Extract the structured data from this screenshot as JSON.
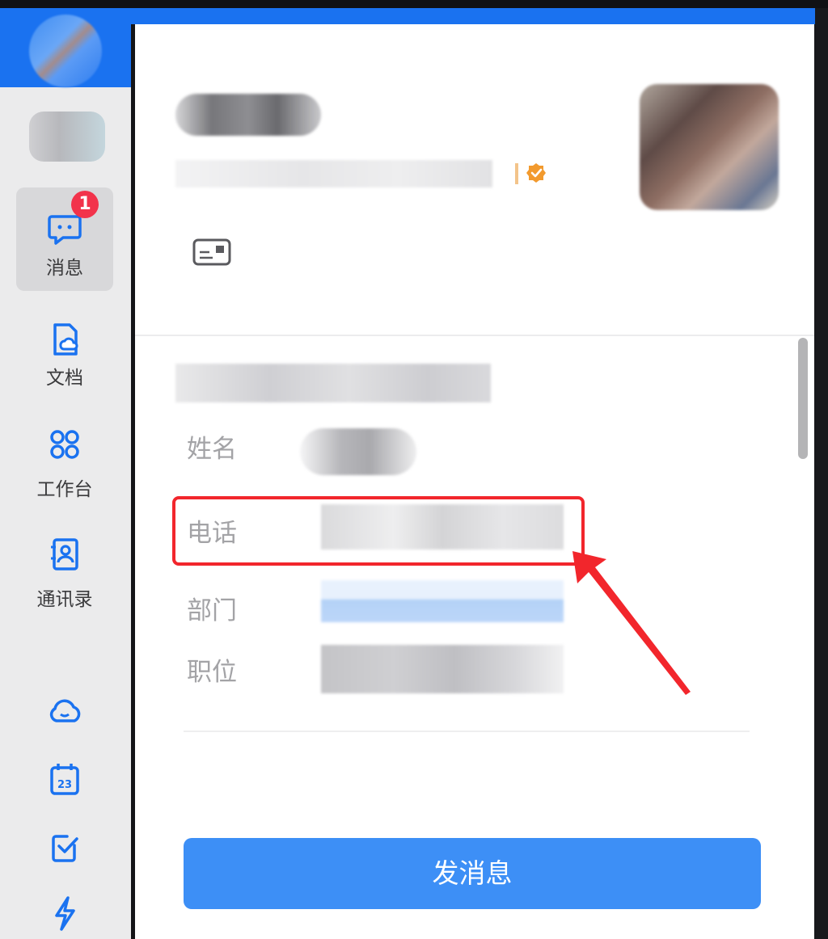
{
  "sidebar": {
    "nav": [
      {
        "label": "消息",
        "badge": "1",
        "icon": "chat-bubble-icon"
      },
      {
        "label": "文档",
        "icon": "document-cloud-icon"
      },
      {
        "label": "工作台",
        "icon": "apps-grid-icon"
      },
      {
        "label": "通讯录",
        "icon": "contacts-book-icon"
      }
    ],
    "bottom_icons": [
      "cloud-icon",
      "calendar-icon",
      "task-check-icon",
      "lightning-icon"
    ],
    "calendar_day": "23"
  },
  "profile": {
    "verified_icon": "verified-badge-icon",
    "card_icon": "business-card-icon",
    "fields": {
      "name_label": "姓名",
      "phone_label": "电话",
      "department_label": "部门",
      "position_label": "职位"
    },
    "send_button": "发消息"
  },
  "colors": {
    "brand_blue": "#1a72f0",
    "button_blue": "#3d8ff6",
    "badge_red": "#f2334b",
    "highlight_red": "#f2262c"
  }
}
